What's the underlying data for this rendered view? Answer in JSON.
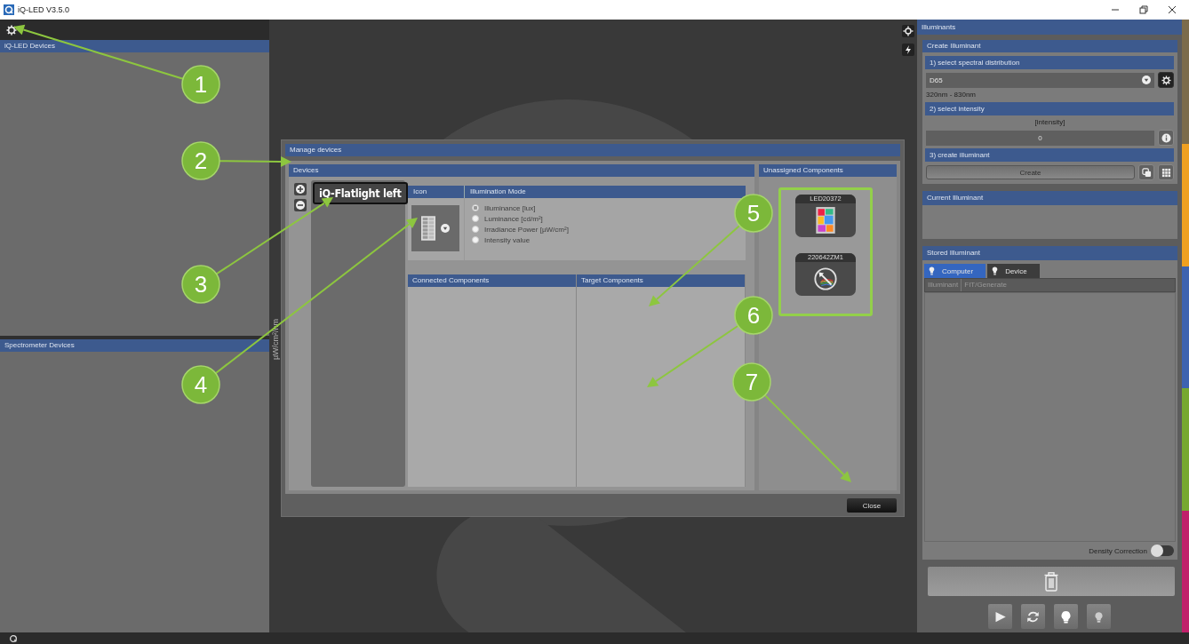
{
  "window": {
    "title": "iQ-LED V3.5.0"
  },
  "left_panels": [
    {
      "title": "iQ-LED Devices"
    },
    {
      "title": "Spectrometer Devices"
    }
  ],
  "chart_axis_label": "µW/cm²/nm",
  "dialog": {
    "title": "Manage devices",
    "devices": {
      "title": "Devices",
      "items": [
        {
          "label": "iQ-Flatlight left",
          "selected": true
        }
      ]
    },
    "settings_table": {
      "columns": [
        "Icon",
        "Illumination Mode"
      ],
      "modes": [
        {
          "label": "Illuminance [lux]",
          "selected": true
        },
        {
          "label": "Luminance [cd/m²]",
          "selected": false
        },
        {
          "label": "Irradiance Power [µW/cm²]",
          "selected": false
        },
        {
          "label": "Intensity value",
          "selected": false
        }
      ]
    },
    "component_panes": [
      "Connected Components",
      "Target Components"
    ],
    "unassigned": {
      "title": "Unassigned Components",
      "components": [
        {
          "label": "LED20372",
          "kind": "light"
        },
        {
          "label": "220642ZM1",
          "kind": "spectrometer"
        }
      ]
    },
    "close_button": "Close"
  },
  "illuminants": {
    "title": "Illuminants",
    "create": {
      "title": "Create Illuminant",
      "step1": "1) select spectral distribution",
      "distribution": "D65",
      "range": "320nm - 830nm",
      "step2": "2) select intensity",
      "intensity_label": "[intensity]",
      "intensity_value": "0",
      "step3": "3) create illuminant",
      "create_button": "Create"
    },
    "current": {
      "title": "Current Illuminant"
    },
    "stored": {
      "title": "Stored Illuminant",
      "tabs": [
        {
          "label": "Computer",
          "selected": true
        },
        {
          "label": "Device",
          "selected": false
        }
      ],
      "columns": [
        "Illuminant",
        "FIT/Generate"
      ],
      "density_correction": {
        "label": "Density Correction",
        "on": false
      }
    }
  },
  "callouts": [
    "1",
    "2",
    "3",
    "4",
    "5",
    "6",
    "7"
  ]
}
